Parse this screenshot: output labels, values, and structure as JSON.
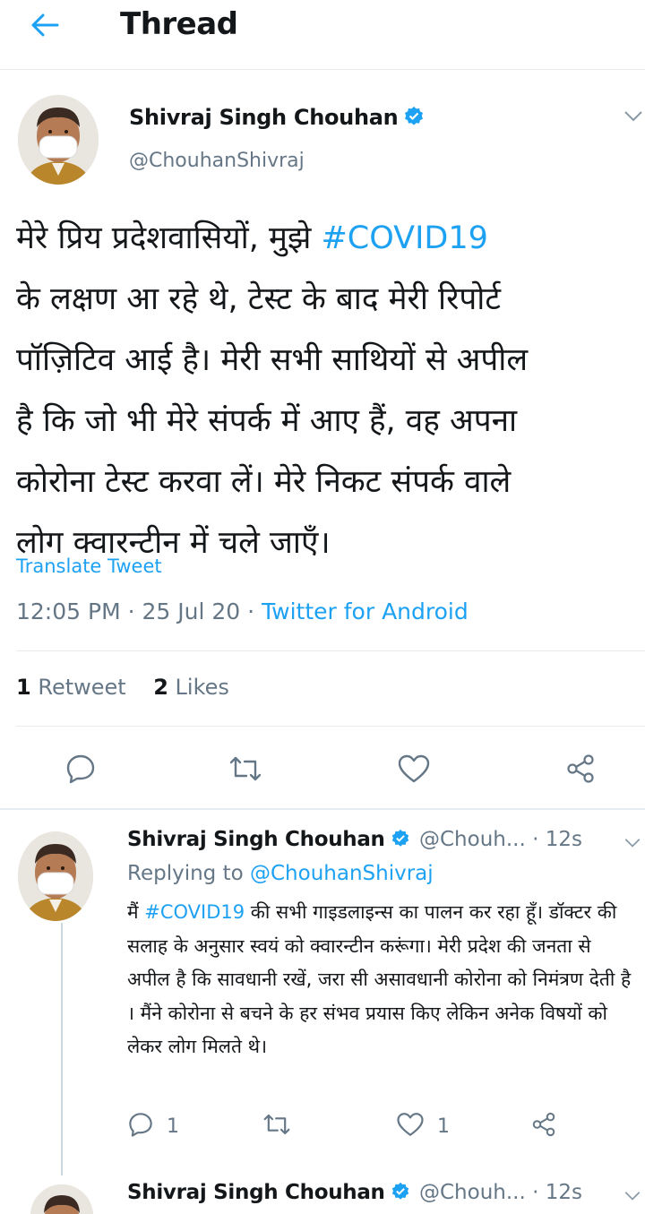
{
  "header": {
    "title": "Thread"
  },
  "tweet": {
    "author_name": "Shivraj Singh Chouhan",
    "handle": "@ChouhanShivraj",
    "text_lines": [
      "मेरे प्रिय प्रदेशवासियों, मुझे ",
      "के लक्षण आ रहे थे, टेस्ट के बाद मेरी रिपोर्ट",
      "पॉज़िटिव आई है। मेरी सभी साथियों से अपील",
      "है कि जो भी मेरे संपर्क में आए हैं, वह अपना",
      "कोरोना टेस्ट करवा लें। मेरे निकट संपर्क वाले",
      "लोग क्वारन्टीन में चले जाएँ।"
    ],
    "hashtag": "#COVID19",
    "translate_label": "Translate Tweet",
    "time": "12:05 PM",
    "date": "25 Jul 20",
    "separator": " · ",
    "source": "Twitter for Android",
    "retweets_count": "1",
    "retweets_label": "Retweet",
    "likes_count": "2",
    "likes_label": "Likes"
  },
  "reply": {
    "author_name": "Shivraj Singh Chouhan",
    "handle_time": "@Chouh... · 12s",
    "replying_prefix": "Replying to ",
    "replying_to": "@ChouhanShivraj",
    "text_prefix": "मैं ",
    "hashtag": "#COVID19",
    "text_rest": " की सभी गाइडलाइन्स का पालन कर रहा हूँ। डॉक्टर की सलाह के अनुसार स्वयं को क्वारन्टीन करूंगा। मेरी प्रदेश की जनता से अपील है कि सावधानी रखें, जरा सी असावधानी कोरोना को निमंत्रण देती है । मैंने कोरोना से बचने के हर संभव प्रयास किए लेकिन अनेक विषयों को लेकर लोग मिलते थे।",
    "reply_count": "1",
    "like_count": "1"
  },
  "next_reply": {
    "author_name": "Shivraj Singh Chouhan",
    "handle_time": "@Chouh... · 12s"
  },
  "colors": {
    "accent": "#1da1f2",
    "muted": "#657786",
    "text": "#14171a",
    "divider": "#e6ecf0"
  }
}
